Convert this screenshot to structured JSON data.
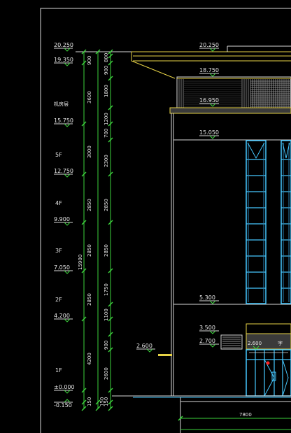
{
  "drawing": {
    "elevation_marks_left": [
      "20.250",
      "19.350",
      "15.750",
      "12.750",
      "9.900",
      "7.050",
      "4.200",
      "±0.000",
      "-0.150"
    ],
    "floor_labels": [
      "5F",
      "4F",
      "3F",
      "2F",
      "1F"
    ],
    "roof_label": "机房层",
    "elevation_marks_building": [
      "20.250",
      "18.750",
      "16.950",
      "15.050",
      "5.300",
      "3.500",
      "2.700",
      "2.600",
      "2.600"
    ],
    "dims_col1": [
      "900",
      "3600",
      "3000",
      "2850",
      "2850",
      "2850",
      "4200",
      "150"
    ],
    "dims_col2": [
      "15900",
      "150"
    ],
    "dims_col3": [
      "800",
      "900",
      "1800",
      "1200",
      "700",
      "2300",
      "2850",
      "2850",
      "1750",
      "1100",
      "900",
      "2600",
      "150"
    ],
    "bottom_dim": "7800",
    "signage_mark": "字",
    "colors": {
      "background": "#000000",
      "dim_line": "#d8d8d8",
      "green": "#3cd23c",
      "yellow": "#e6d246",
      "cyan": "#46c8ff",
      "white": "#ffffff",
      "red": "#ff2020"
    }
  }
}
